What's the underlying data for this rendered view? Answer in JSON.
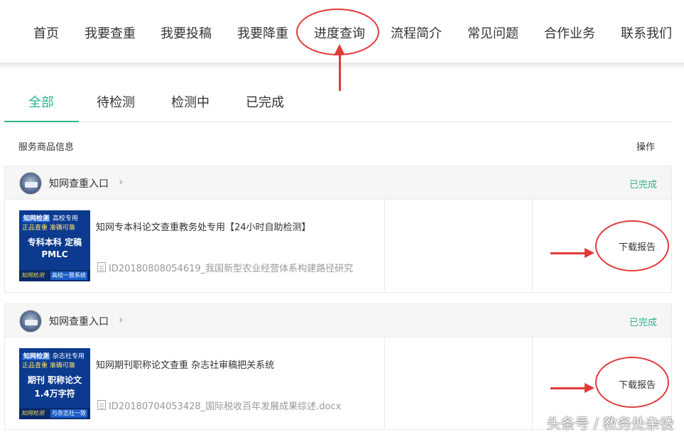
{
  "nav": {
    "items": [
      "首页",
      "我要查重",
      "我要投稿",
      "我要降重",
      "进度查询",
      "流程简介",
      "常见问题",
      "合作业务",
      "联系我们"
    ]
  },
  "tabs": [
    "全部",
    "待检测",
    "检测中",
    "已完成"
  ],
  "columns": {
    "info": "服务商品信息",
    "action": "操作"
  },
  "orders": [
    {
      "shop": "知网查重入口",
      "status": "已完成",
      "thumb": {
        "row1_a": "知网检测",
        "row1_b": "高校专用",
        "row2": "正品查重  准确可靠",
        "big1": "专科本科 定稿",
        "big2": "PMLC",
        "foot_l": "知网检测",
        "foot_r": "高校一致系统"
      },
      "title": "知网专本科论文查重教务处专用【24小时自助检测】",
      "file": "ID20180808054619_我国新型农业经营体系构建路径研究",
      "action": "下载报告"
    },
    {
      "shop": "知网查重入口",
      "status": "已完成",
      "thumb": {
        "row1_a": "知网检测",
        "row1_b": "杂志社专用",
        "row2": "正品查重  准确可靠",
        "big1": "期刊 职称论文",
        "big2": "1.4万字符",
        "foot_l": "知网检测",
        "foot_r": "与杂志社一致"
      },
      "title": "知网期刊职称论文查重 杂志社审稿把关系统",
      "file": "ID20180704053428_国际税收百年发展成果综述.docx",
      "action": "下载报告"
    }
  ],
  "watermark": "头条号 / 教务处杂役",
  "colors": {
    "accent": "#2db48c",
    "annotation": "#e23a3a",
    "thumb_bg": "#0b3a8f"
  }
}
